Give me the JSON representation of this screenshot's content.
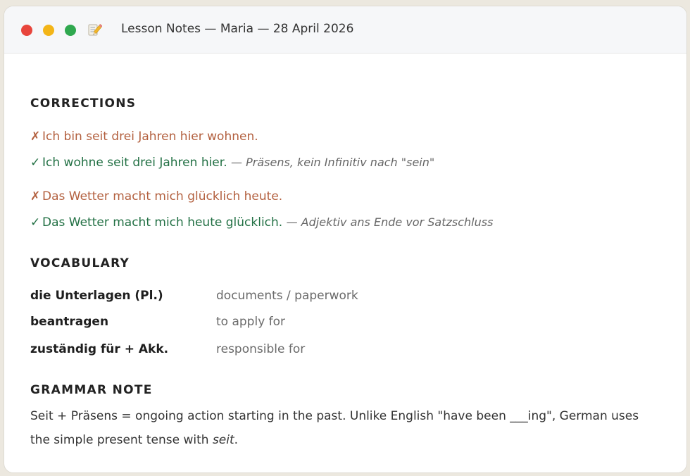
{
  "window": {
    "title": "Lesson Notes — Maria — 28 April 2026",
    "icon": "memo-pencil-icon"
  },
  "corrections": {
    "heading": "CORRECTIONS",
    "items": [
      {
        "wrong": "Ich bin seit drei Jahren hier wohnen.",
        "right": "Ich wohne seit drei Jahren hier.",
        "note": "— Präsens, kein Infinitiv nach \"sein\""
      },
      {
        "wrong": "Das Wetter macht mich glücklich heute.",
        "right": "Das Wetter macht mich heute glücklich.",
        "note": "— Adjektiv ans Ende vor Satzschluss"
      }
    ],
    "wrong_mark": "✗",
    "right_mark": "✓"
  },
  "vocabulary": {
    "heading": "VOCABULARY",
    "items": [
      {
        "term": "die Unterlagen (Pl.)",
        "meaning": "documents / paperwork"
      },
      {
        "term": "beantragen",
        "meaning": "to apply for"
      },
      {
        "term": "zuständig für + Akk.",
        "meaning": "responsible for"
      }
    ]
  },
  "grammar": {
    "heading": "GRAMMAR NOTE",
    "text_before": "Seit + Präsens = ongoing action starting in the past. Unlike English \"have been ___ing\", German uses the simple present tense with ",
    "emphasis": "seit",
    "text_after": "."
  },
  "colors": {
    "wrong": "#b3603f",
    "right": "#227044",
    "close": "#e8453c",
    "minimize": "#f3b518",
    "maximize": "#2fa84f"
  }
}
